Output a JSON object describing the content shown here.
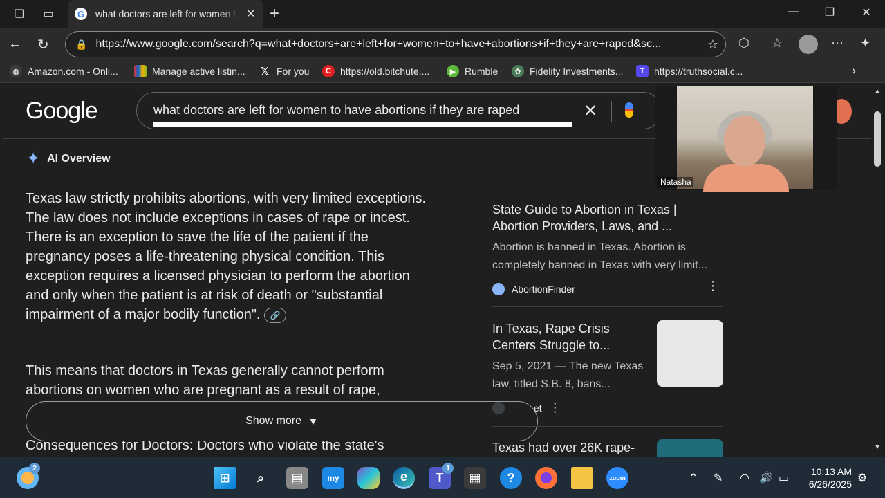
{
  "browser": {
    "tab_title": "what doctors are left for women t",
    "url": "https://www.google.com/search?q=what+doctors+are+left+for+women+to+have+abortions+if+they+are+raped&sc...",
    "bookmarks": [
      "Amazon.com - Onli...",
      "Manage active listin...",
      "For you",
      "https://old.bitchute....",
      "Rumble",
      "Fidelity Investments...",
      "https://truthsocial.c..."
    ]
  },
  "google": {
    "logo": "Google",
    "query": "what doctors are left for women to have abortions if they are raped"
  },
  "video": {
    "participant": "Natasha"
  },
  "ai_overview": {
    "heading": "AI Overview",
    "para1": "Texas law strictly prohibits abortions, with very limited exceptions. The law does not include exceptions in cases of rape or incest. There is an exception to save the life of the patient if the pregnancy poses a life-threatening physical condition. This exception requires a licensed physician to perform the abortion and only when the patient is at risk of death or \"substantial impairment of a major bodily function\".",
    "para2": "This means that doctors in Texas generally cannot perform abortions on women who are pregnant as a result of rape,",
    "para3": "Consequences for Doctors: Doctors who violate the state's",
    "show_more": "Show more"
  },
  "sources": [
    {
      "title": "State Guide to Abortion in Texas | Abortion Providers, Laws, and ...",
      "snippet": "Abortion is banned in Texas. Abortion is completely banned in Texas with very limit...",
      "site": "AbortionFinder"
    },
    {
      "title": "In Texas, Rape Crisis Centers Struggle to...",
      "snippet": "Sep 5, 2021 — The new Texas law, titled S.B. 8, bans...",
      "site": "et"
    },
    {
      "title": "Texas had over 26K rape-"
    }
  ],
  "taskbar": {
    "time": "10:13 AM",
    "date": "6/26/2025",
    "weather_badge": "2",
    "teams_badge": "1"
  },
  "colors": {
    "accent": "#8ab4f8",
    "background": "#1f1f1f",
    "taskbar": "#202b38"
  }
}
